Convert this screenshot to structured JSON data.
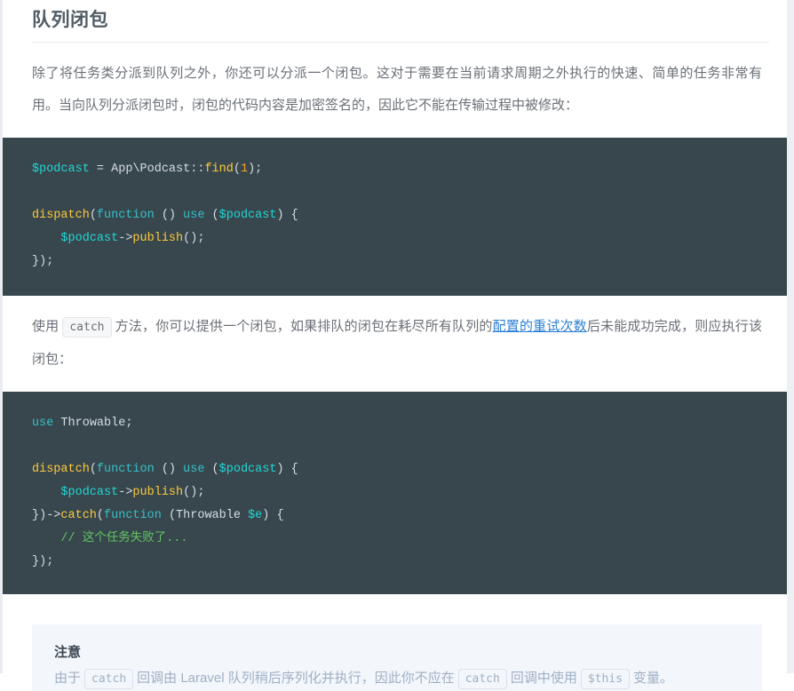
{
  "section": {
    "heading": "队列闭包",
    "paragraph_1": "除了将任务类分派到队列之外，你还可以分派一个闭包。这对于需要在当前请求周期之外执行的快速、简单的任务非常有用。当向队列分派闭包时，闭包的代码内容是加密签名的，因此它不能在传输过程中被修改：",
    "paragraph_2": {
      "part_1": "使用",
      "code_1": "catch",
      "part_2": "方法，你可以提供一个闭包，如果排队的闭包在耗尽所有队列的",
      "link_text": "配置的重试次数",
      "part_3": "后未能成功完成，则应执行该闭包："
    }
  },
  "code_block_1": {
    "language": "php",
    "lines": [
      {
        "tokens": [
          {
            "text": "$podcast",
            "cls": "t-var"
          },
          {
            "text": " = ",
            "cls": "t-plain"
          },
          {
            "text": "App\\Podcast::",
            "cls": "t-plain"
          },
          {
            "text": "find",
            "cls": "t-fn"
          },
          {
            "text": "(",
            "cls": "t-punc"
          },
          {
            "text": "1",
            "cls": "t-num"
          },
          {
            "text": ");",
            "cls": "t-punc"
          }
        ]
      },
      {
        "tokens": []
      },
      {
        "tokens": [
          {
            "text": "dispatch",
            "cls": "t-fn"
          },
          {
            "text": "(",
            "cls": "t-punc"
          },
          {
            "text": "function",
            "cls": "t-kw"
          },
          {
            "text": " () ",
            "cls": "t-plain"
          },
          {
            "text": "use",
            "cls": "t-kw"
          },
          {
            "text": " (",
            "cls": "t-plain"
          },
          {
            "text": "$podcast",
            "cls": "t-var"
          },
          {
            "text": ") {",
            "cls": "t-punc"
          }
        ]
      },
      {
        "tokens": [
          {
            "text": "    ",
            "cls": "t-plain"
          },
          {
            "text": "$podcast",
            "cls": "t-var"
          },
          {
            "text": "->",
            "cls": "t-plain"
          },
          {
            "text": "publish",
            "cls": "t-fn"
          },
          {
            "text": "();",
            "cls": "t-punc"
          }
        ]
      },
      {
        "tokens": [
          {
            "text": "});",
            "cls": "t-punc"
          }
        ]
      }
    ]
  },
  "code_block_2": {
    "language": "php",
    "lines": [
      {
        "tokens": [
          {
            "text": "use",
            "cls": "t-kw"
          },
          {
            "text": " Throwable;",
            "cls": "t-plain"
          }
        ]
      },
      {
        "tokens": []
      },
      {
        "tokens": [
          {
            "text": "dispatch",
            "cls": "t-fn"
          },
          {
            "text": "(",
            "cls": "t-punc"
          },
          {
            "text": "function",
            "cls": "t-kw"
          },
          {
            "text": " () ",
            "cls": "t-plain"
          },
          {
            "text": "use",
            "cls": "t-kw"
          },
          {
            "text": " (",
            "cls": "t-plain"
          },
          {
            "text": "$podcast",
            "cls": "t-var"
          },
          {
            "text": ") {",
            "cls": "t-punc"
          }
        ]
      },
      {
        "tokens": [
          {
            "text": "    ",
            "cls": "t-plain"
          },
          {
            "text": "$podcast",
            "cls": "t-var"
          },
          {
            "text": "->",
            "cls": "t-plain"
          },
          {
            "text": "publish",
            "cls": "t-fn"
          },
          {
            "text": "();",
            "cls": "t-punc"
          }
        ]
      },
      {
        "tokens": [
          {
            "text": "})->",
            "cls": "t-plain"
          },
          {
            "text": "catch",
            "cls": "t-fn"
          },
          {
            "text": "(",
            "cls": "t-punc"
          },
          {
            "text": "function",
            "cls": "t-kw"
          },
          {
            "text": " (Throwable ",
            "cls": "t-plain"
          },
          {
            "text": "$e",
            "cls": "t-var"
          },
          {
            "text": ") {",
            "cls": "t-punc"
          }
        ]
      },
      {
        "tokens": [
          {
            "text": "    // 这个任务失败了...",
            "cls": "t-cmt"
          }
        ]
      },
      {
        "tokens": [
          {
            "text": "});",
            "cls": "t-punc"
          }
        ]
      }
    ]
  },
  "note": {
    "title": "注意",
    "part_1": "由于",
    "code_1": "catch",
    "part_2": "回调由 Laravel 队列稍后序列化并执行，因此你不应在",
    "code_2": "catch",
    "part_3": "回调中使用",
    "code_3": "$this",
    "part_4": "变量。"
  },
  "colors": {
    "code_background": "#37474d",
    "code_text": "#d7dee2",
    "token_variable": "#24d4d4",
    "token_function": "#ffc83d",
    "token_keyword": "#38bec9",
    "token_number": "#f5a623",
    "token_comment": "#62c462",
    "link": "#2b7fd4",
    "heading": "#515b63",
    "body_text": "#6b7077",
    "note_background": "#f3f6fb",
    "note_text": "#9fb0c4"
  }
}
